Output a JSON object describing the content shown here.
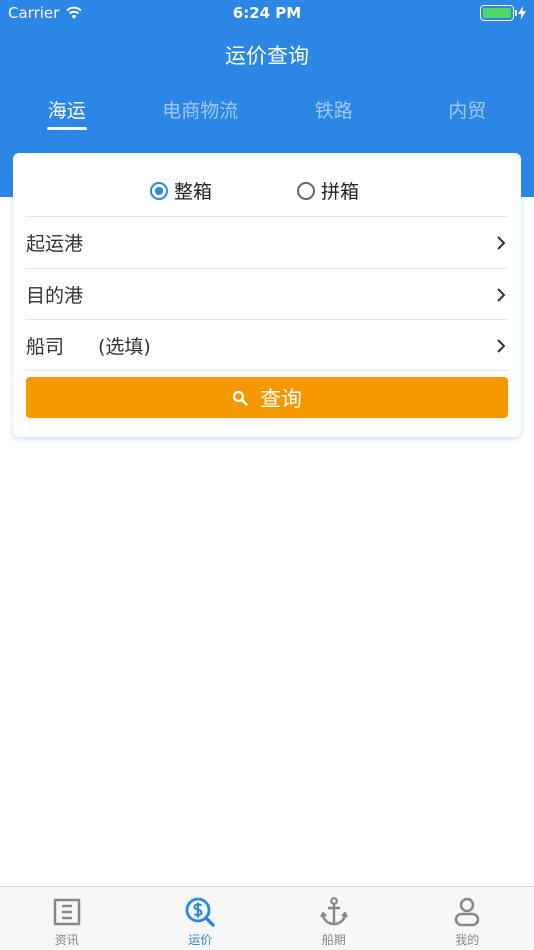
{
  "status_bar": {
    "carrier": "Carrier",
    "time": "6:24 PM"
  },
  "nav": {
    "title": "运价查询"
  },
  "tabs": [
    {
      "label": "海运",
      "active": true
    },
    {
      "label": "电商物流",
      "active": false
    },
    {
      "label": "铁路",
      "active": false
    },
    {
      "label": "内贸",
      "active": false
    }
  ],
  "container_type": {
    "options": [
      {
        "label": "整箱",
        "checked": true
      },
      {
        "label": "拼箱",
        "checked": false
      }
    ]
  },
  "form": {
    "origin_label": "起运港",
    "destination_label": "目的港",
    "carrier_label": "船司",
    "carrier_hint": "(选填)"
  },
  "query_button": {
    "label": "查询"
  },
  "tabbar": {
    "items": [
      {
        "label": "资讯",
        "icon": "news-icon",
        "active": false
      },
      {
        "label": "运价",
        "icon": "price-search-icon",
        "active": true
      },
      {
        "label": "船期",
        "icon": "anchor-icon",
        "active": false
      },
      {
        "label": "我的",
        "icon": "user-icon",
        "active": false
      }
    ]
  },
  "colors": {
    "primary": "#2b86e6",
    "accent": "#f59800",
    "battery": "#4cd964"
  }
}
